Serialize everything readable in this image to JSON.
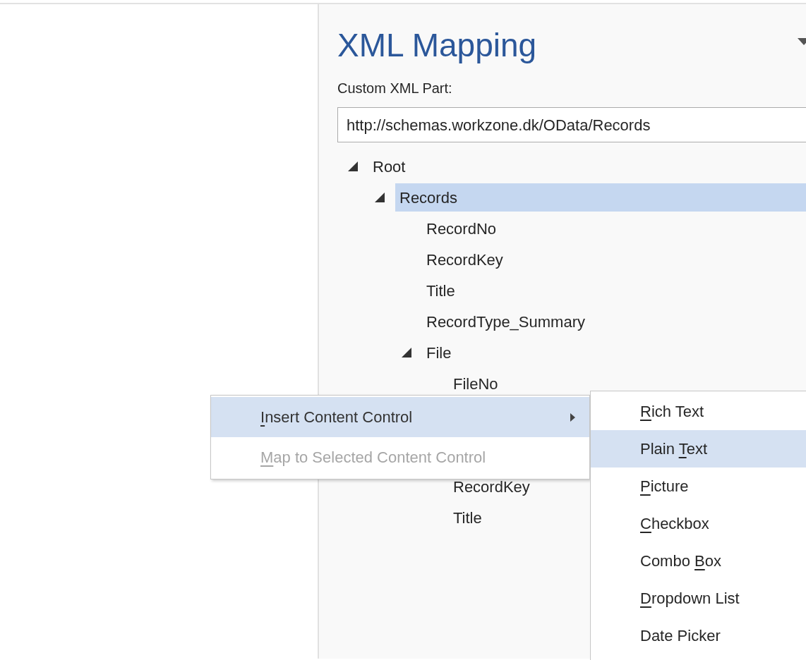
{
  "pane": {
    "title": "XML Mapping",
    "part_label": "Custom XML Part:",
    "part_value": "http://schemas.workzone.dk/OData/Records"
  },
  "tree": [
    {
      "label": "Root",
      "expanded": true,
      "selected": false,
      "children": [
        {
          "label": "Records",
          "expanded": true,
          "selected": true,
          "children": [
            {
              "label": "RecordNo",
              "selected": false
            },
            {
              "label": "RecordKey",
              "selected": false
            },
            {
              "label": "Title",
              "selected": false
            },
            {
              "label": "RecordType_Summary",
              "selected": false
            },
            {
              "label": "File",
              "expanded": true,
              "selected": false,
              "children": [
                {
                  "label": "FileNo",
                  "selected": false
                },
                {
                  "label": "RecordKey",
                  "selected": false
                },
                {
                  "label": "Title",
                  "selected": false
                }
              ]
            }
          ]
        }
      ]
    }
  ],
  "context_menu": [
    {
      "key": "I",
      "post": "nsert Content Control",
      "selected": true,
      "disabled": false,
      "submenu": true
    },
    {
      "key": "M",
      "post": "ap to Selected Content Control",
      "selected": false,
      "disabled": true,
      "submenu": false
    }
  ],
  "submenu": [
    {
      "key": "R",
      "post": "ich Text",
      "selected": false
    },
    {
      "pre": "Plain ",
      "key": "T",
      "post": "ext",
      "selected": true
    },
    {
      "key": "P",
      "post": "icture",
      "selected": false
    },
    {
      "key": "C",
      "post": "heckbox",
      "selected": false
    },
    {
      "pre": "Combo ",
      "key": "B",
      "post": "ox",
      "selected": false
    },
    {
      "key": "D",
      "post": "ropdown List",
      "selected": false
    },
    {
      "post": "Date Picker",
      "selected": false
    }
  ]
}
